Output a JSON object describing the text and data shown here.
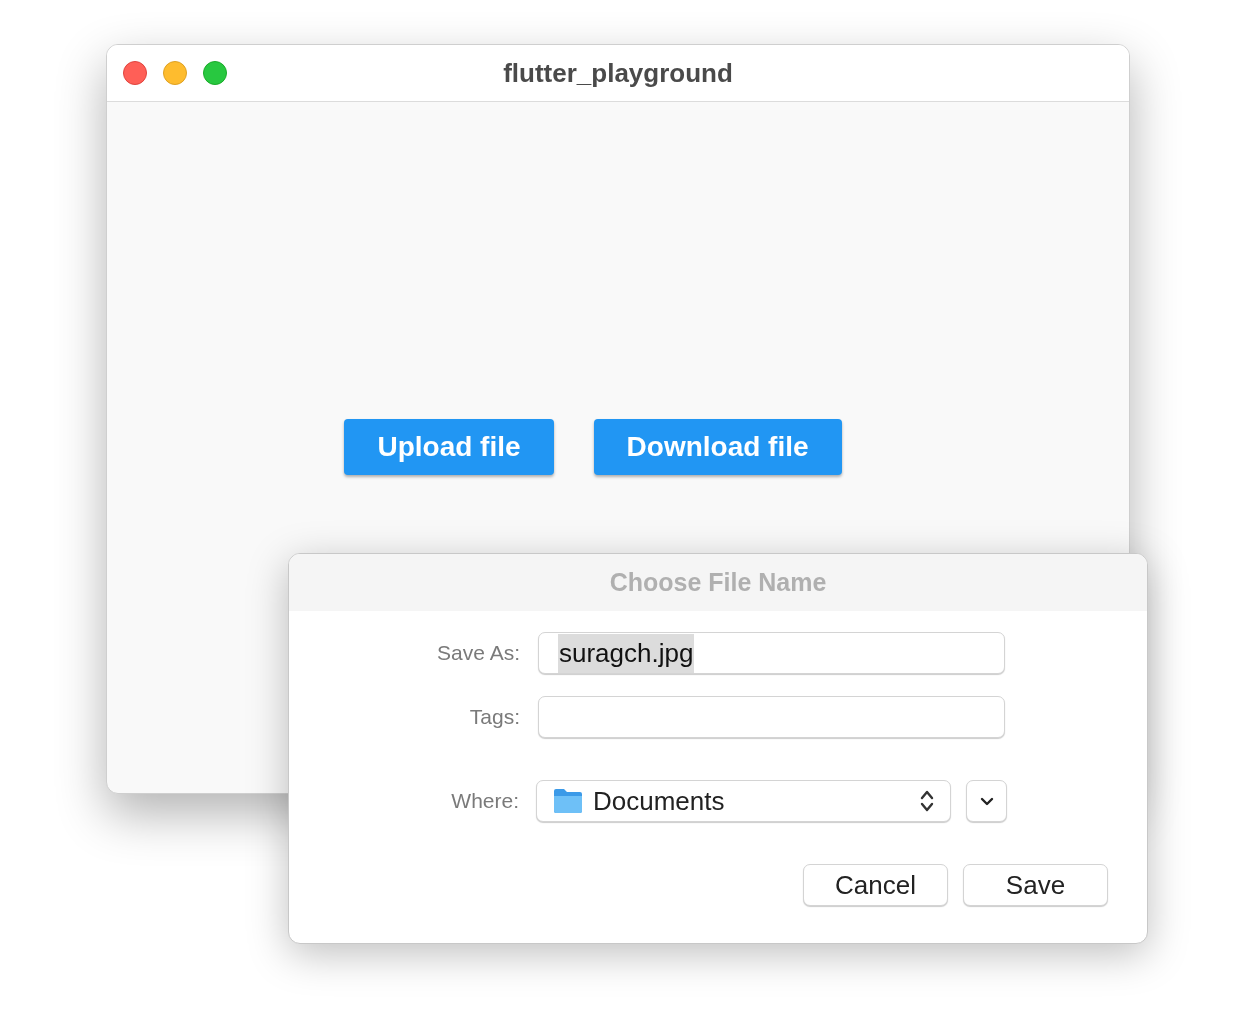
{
  "window": {
    "title": "flutter_playground"
  },
  "buttons": [
    {
      "label": "Upload file"
    },
    {
      "label": "Download file"
    }
  ],
  "dialog": {
    "title": "Choose File Name",
    "fields": [
      {
        "label": "Save As:",
        "value": "suragch.jpg",
        "value_selected": true
      },
      {
        "label": "Tags:"
      }
    ],
    "where": {
      "label": "Where:",
      "value": "Documents"
    },
    "buttons": [
      "Cancel",
      "Save"
    ]
  }
}
